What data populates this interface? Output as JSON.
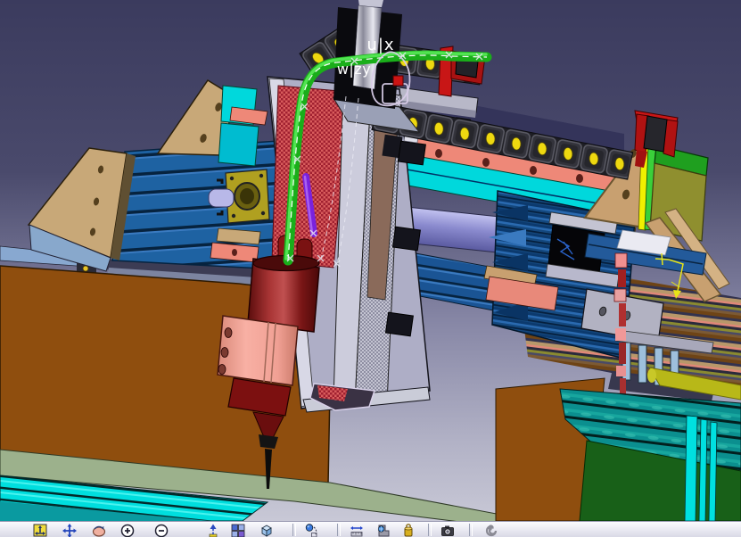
{
  "viewport": {
    "annotations": {
      "label_ux": "u|x",
      "label_wzy": "w|zy"
    },
    "colors": {
      "background_top": "#3b3b5e",
      "background_bottom": "#c6c6d6",
      "beam_blue": "#1e62a2",
      "cyan_rail": "#00e2e2",
      "salmon_bar": "#ee8878",
      "tan_plate": "#c8a070",
      "table_brown": "#8f4e0e",
      "spindle_red": "#8a1a1a",
      "tube_green": "#1aae1a",
      "tube_purple": "#7a22dd",
      "chain_dot_yellow": "#eed810",
      "clamp_red": "#c81616",
      "dimension_yellow": "#e8e416",
      "panel_green": "#186018",
      "teal_band": "#0b8f8f",
      "olive_plate": "#8f8f2f"
    }
  },
  "toolbar": {
    "icons": [
      {
        "name": "fit-all-in"
      },
      {
        "name": "pan"
      },
      {
        "name": "rotate"
      },
      {
        "name": "zoom-in"
      },
      {
        "name": "zoom-out"
      },
      {
        "name": "normal-view"
      },
      {
        "name": "multi-view"
      },
      {
        "name": "iso-view"
      },
      {
        "name": "hide-show"
      },
      {
        "name": "measure-between"
      },
      {
        "name": "measure-item"
      },
      {
        "name": "measure-inertia"
      },
      {
        "name": "camera"
      },
      {
        "name": "spiral"
      }
    ]
  }
}
